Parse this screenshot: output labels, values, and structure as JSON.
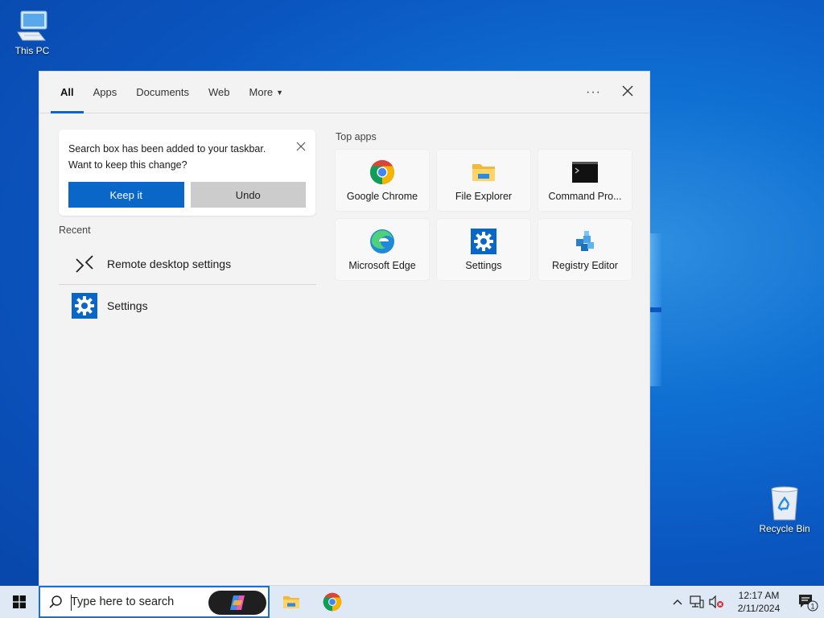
{
  "desktop": {
    "icons": [
      {
        "label": "This PC",
        "icon": "computer-icon"
      },
      {
        "label": "Recycle Bin",
        "icon": "recycle-bin-icon"
      }
    ]
  },
  "search_panel": {
    "tabs": [
      {
        "label": "All",
        "active": true
      },
      {
        "label": "Apps"
      },
      {
        "label": "Documents"
      },
      {
        "label": "Web"
      },
      {
        "label": "More"
      }
    ],
    "more_options_label": "···",
    "notice": {
      "text_line1": "Search box has been added to your taskbar.",
      "text_line2": "Want to keep this change?",
      "keep_label": "Keep it",
      "undo_label": "Undo"
    },
    "recent_title": "Recent",
    "recent_items": [
      {
        "label": "Remote desktop settings",
        "icon": "remote-desktop-icon"
      },
      {
        "label": "Settings",
        "icon": "settings-gear-icon"
      }
    ],
    "top_apps_title": "Top apps",
    "top_apps": [
      {
        "label": "Google Chrome",
        "icon": "chrome-icon"
      },
      {
        "label": "File Explorer",
        "icon": "folder-icon"
      },
      {
        "label": "Command Pro...",
        "icon": "terminal-icon"
      },
      {
        "label": "Microsoft Edge",
        "icon": "edge-icon"
      },
      {
        "label": "Settings",
        "icon": "settings-gear-icon"
      },
      {
        "label": "Registry Editor",
        "icon": "registry-icon"
      }
    ]
  },
  "taskbar": {
    "search_placeholder": "Type here to search",
    "clock_time": "12:17 AM",
    "clock_date": "2/11/2024",
    "notification_count": "1"
  },
  "colors": {
    "accent": "#0a67c8",
    "panel_bg": "#f3f3f3",
    "taskbar_bg": "#dfe9f5"
  }
}
